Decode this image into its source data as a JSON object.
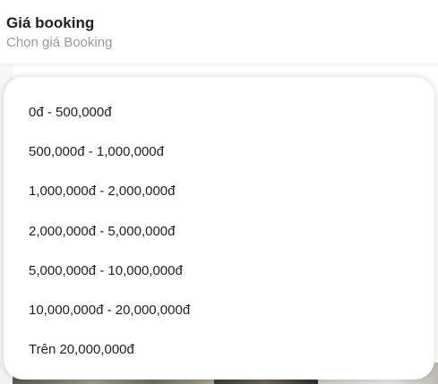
{
  "field": {
    "label": "Giá booking",
    "placeholder": "Chọn giá Booking"
  },
  "dropdown": {
    "options": [
      "0đ - 500,000đ",
      "500,000đ - 1,000,000đ",
      "1,000,000đ - 2,000,000đ",
      "2,000,000đ - 5,000,000đ",
      "5,000,000đ - 10,000,000đ",
      "10,000,000đ - 20,000,000đ",
      "Trên 20,000,000đ"
    ]
  }
}
